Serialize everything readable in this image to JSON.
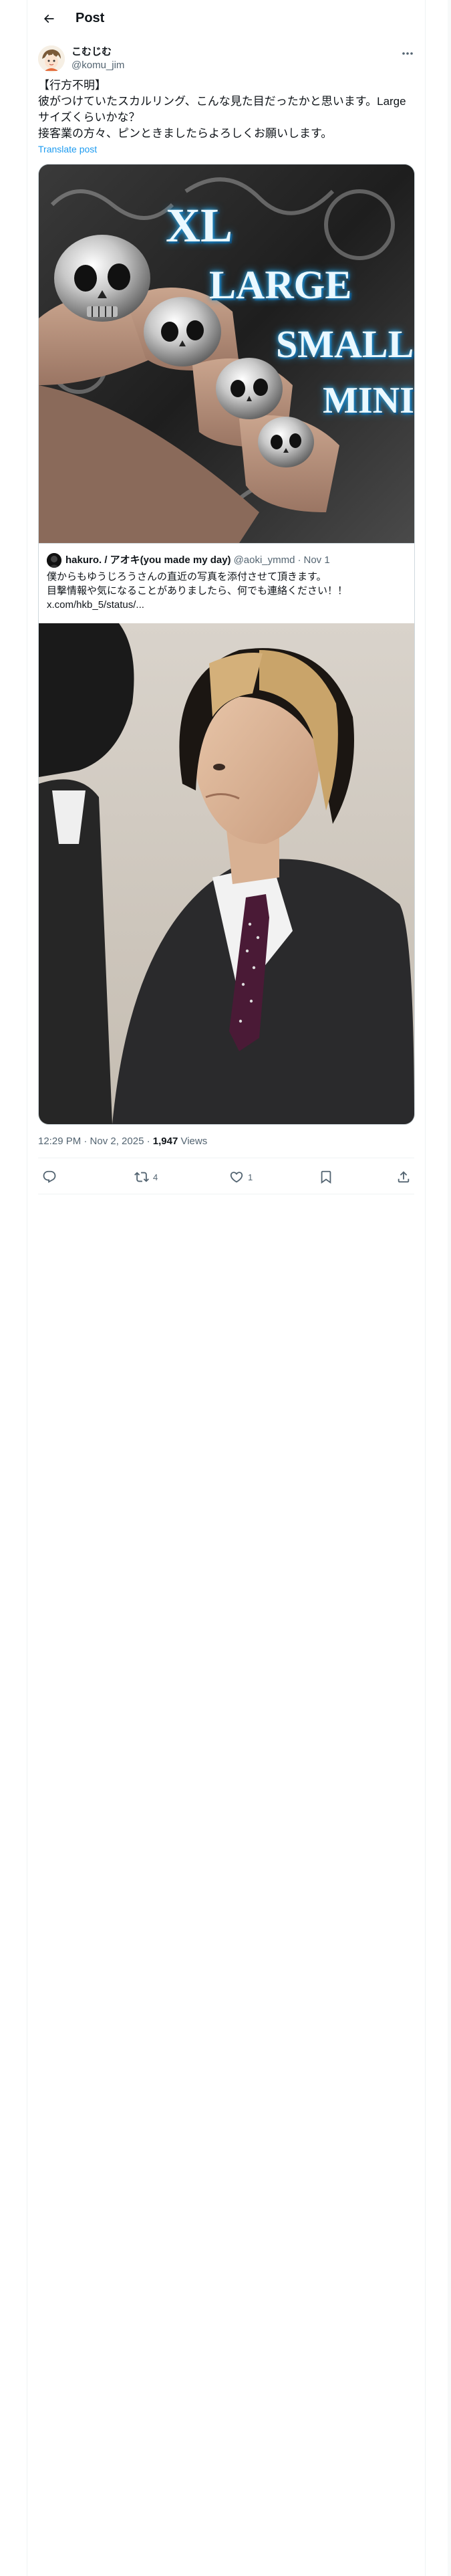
{
  "header": {
    "title": "Post"
  },
  "author": {
    "name": "こむじむ",
    "handle": "@komu_jim"
  },
  "tweet": {
    "text": "【行方不明】\n彼がつけていたスカルリング、こんな見た目だったかと思います。Large\nサイズくらいかな？\n接客業の方々、ピンときましたらよろしくお願いします。",
    "translate_label": "Translate post"
  },
  "media": {
    "ring_labels": [
      "XL",
      "LARGE",
      "SMALL",
      "MINI"
    ]
  },
  "quote": {
    "name": "hakuro. / アオキ(you made my day)",
    "handle": "@aoki_ymmd",
    "dot": "·",
    "date": "Nov 1",
    "text": "僕からもゆうじろうさんの直近の写真を添付させて頂きます。\n目撃情報や気になることがありましたら、何でも連絡ください！！\nx.com/hkb_5/status/..."
  },
  "meta": {
    "time": "12:29 PM · Nov 2, 2025 · ",
    "views_count": "1,947",
    "views_label": " Views"
  },
  "actions": {
    "reply_count": "",
    "repost_count": "4",
    "like_count": "1"
  },
  "colors": {
    "accent": "#1d9bf0",
    "secondary_text": "#536471",
    "border": "#cfd9de"
  }
}
